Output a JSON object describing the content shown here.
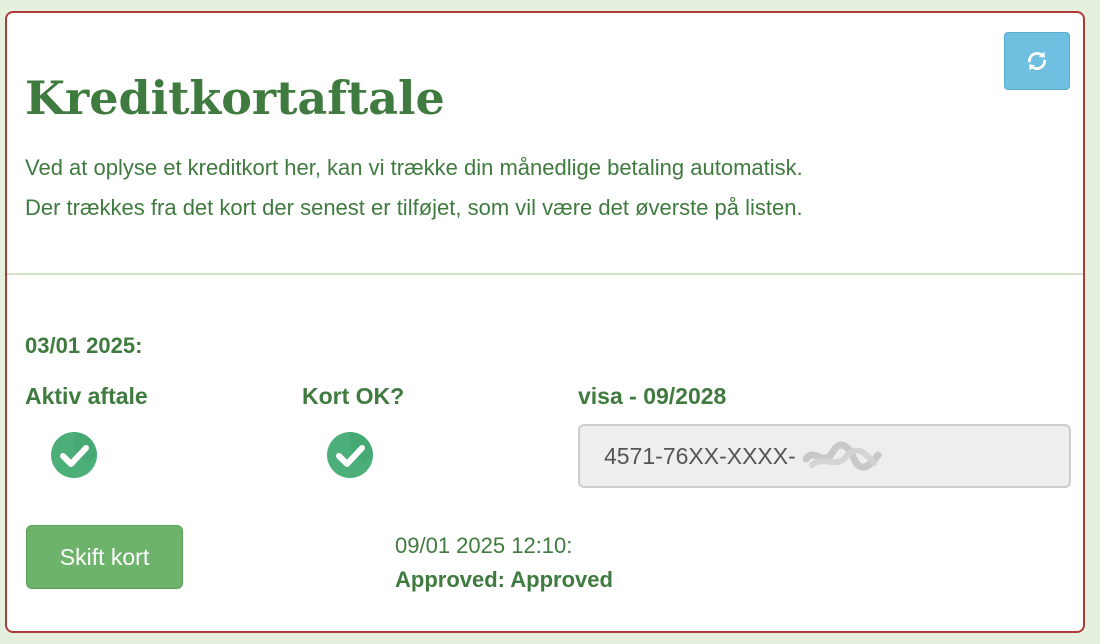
{
  "header": {
    "title": "Kreditkortaftale",
    "description_line1": "Ved at oplyse et kreditkort her, kan vi trække din månedlige betaling automatisk.",
    "description_line2": "Der trækkes fra det kort der senest er tilføjet, som vil være det øverste på listen.",
    "refresh_icon": "refresh-icon"
  },
  "agreement": {
    "date": "03/01 2025:",
    "active_label": "Aktiv aftale",
    "active_icon": "check-circle-icon",
    "card_ok_label": "Kort OK?",
    "card_ok_icon": "check-circle-icon",
    "card_type_label": "visa - 09/2028",
    "card_number": "4571-76XX-XXXX-"
  },
  "actions": {
    "change_card_label": "Skift kort"
  },
  "status": {
    "timestamp": "09/01 2025 12:10:",
    "result": "Approved: Approved"
  },
  "colors": {
    "text_green": "#3f7a3f",
    "button_green": "#6db36b",
    "refresh_blue": "#6fbfe0",
    "border_red": "#b03a3a",
    "check_green": "#4caf7a"
  }
}
